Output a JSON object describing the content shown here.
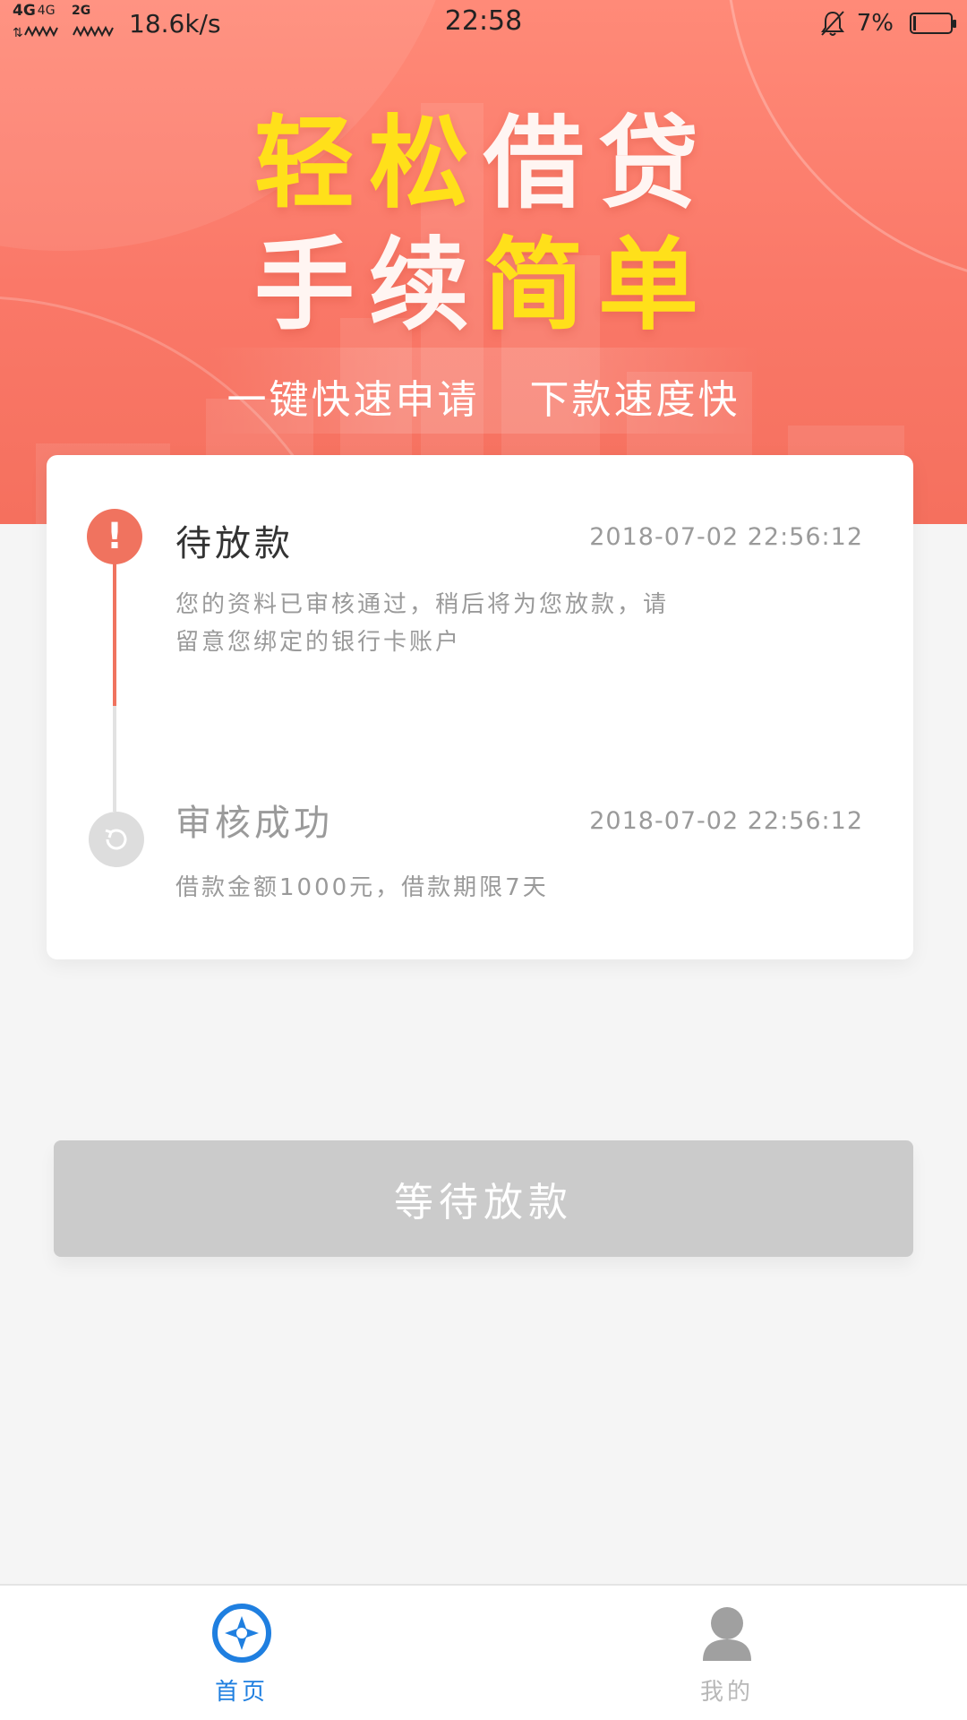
{
  "status_bar": {
    "network_1": "4G",
    "network_2": "4G",
    "network_3": "2G",
    "speed": "18.6k/s",
    "time": "22:58",
    "battery": "7%"
  },
  "banner": {
    "headline_1_yellow": "轻松",
    "headline_1_white": "借贷",
    "headline_2_white": "手续",
    "headline_2_yellow": "简单",
    "sub_1": "一键快速申请",
    "sub_2": "下款速度快"
  },
  "timeline": {
    "steps": [
      {
        "title": "待放款",
        "time": "2018-07-02 22:56:12",
        "desc": "您的资料已审核通过，稍后将为您放款，请留意您绑定的银行卡账户"
      },
      {
        "title": "审核成功",
        "time": "2018-07-02 22:56:12",
        "desc": "借款金额1000元，借款期限7天"
      }
    ]
  },
  "action": {
    "button_label": "等待放款"
  },
  "nav": {
    "home_label": "首页",
    "mine_label": "我的"
  },
  "colors": {
    "accent": "#f0735f",
    "nav_active": "#1f7fe0",
    "button_disabled": "#cbcbcb"
  }
}
